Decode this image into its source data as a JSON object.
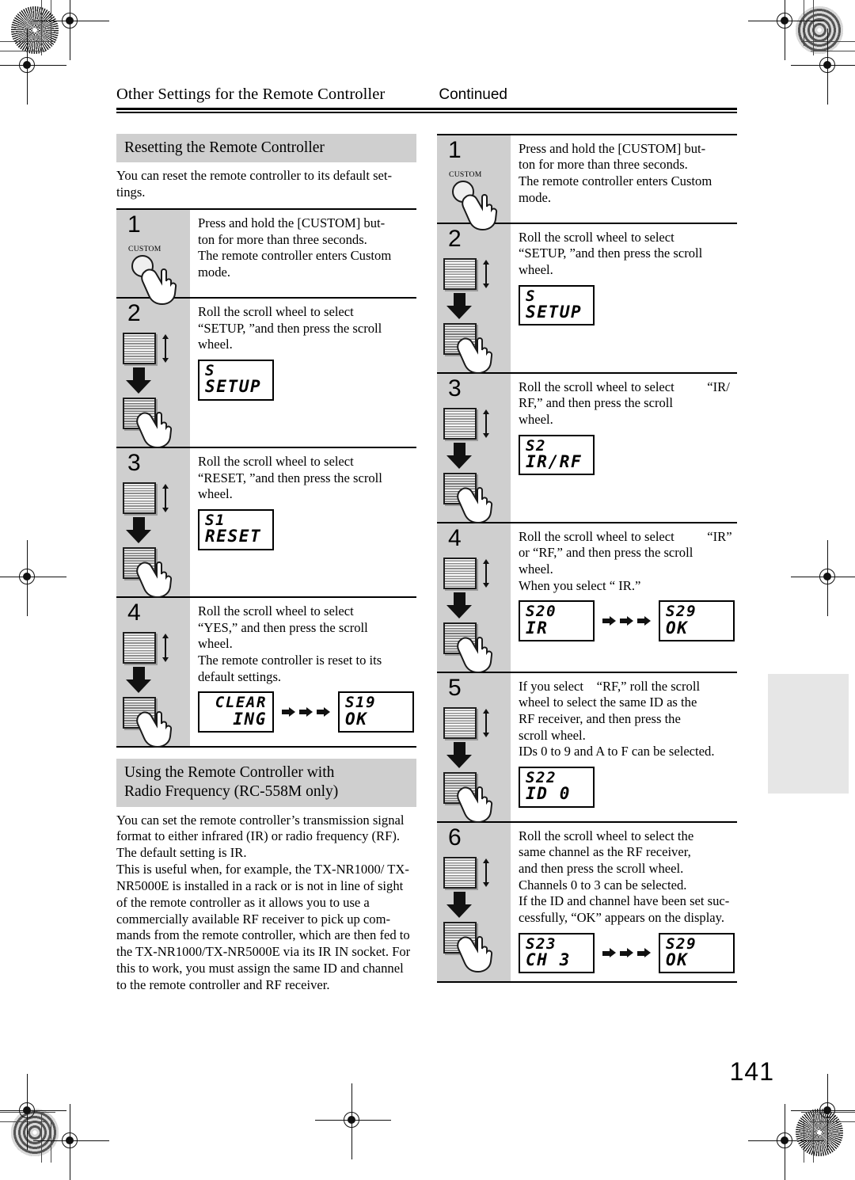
{
  "document": {
    "running_head": "Other Settings for the Remote Controller",
    "continued_label": "Continued",
    "page_number": "141"
  },
  "left_column": {
    "section": {
      "heading": "Resetting the Remote Controller",
      "intro": "You can reset the remote controller to its default set-tings."
    },
    "steps": [
      {
        "number": "1",
        "icon": "custom-button",
        "icon_label": "CUSTOM",
        "lines": [
          "Press and hold the [CUSTOM] but-",
          "ton for more than three seconds.",
          "The remote controller enters Custom",
          "mode."
        ],
        "displays": []
      },
      {
        "number": "2",
        "icon": "scroll-wheel",
        "lines": [
          "Roll the scroll wheel to select",
          "“SETUP, ”and then press the scroll",
          "wheel."
        ],
        "displays": [
          {
            "line1": "S",
            "line2": "SETUP",
            "align": "left"
          }
        ]
      },
      {
        "number": "3",
        "icon": "scroll-wheel",
        "lines": [
          "Roll the scroll wheel to select",
          "“RESET, ”and then press the scroll",
          "wheel."
        ],
        "displays": [
          {
            "line1": "S1",
            "line2": "RESET",
            "align": "left"
          }
        ]
      },
      {
        "number": "4",
        "icon": "scroll-wheel",
        "lines": [
          "Roll the scroll wheel to select",
          "“YES,” and then press the scroll",
          "wheel.",
          "The remote controller is reset to its",
          "default settings."
        ],
        "displays": [
          {
            "line1": "CLEAR",
            "line2": "ING",
            "align": "right"
          },
          {
            "arrows": 3
          },
          {
            "line1": "S19",
            "line2": "OK",
            "align": "left"
          }
        ]
      }
    ],
    "section2": {
      "heading_line1": "Using the Remote Controller with",
      "heading_line2": "Radio Frequency (RC-558M only)",
      "paragraphs": [
        "You can set the remote controller’s transmission signal format to either infrared (IR) or radio frequency (RF). The default setting is IR.",
        "This is useful when, for example, the TX-NR1000/ TX-NR5000E is installed in a rack or is not in line of sight of the remote controller as it allows you to use a commercially available RF receiver to pick up com-mands from the remote controller, which are then fed to the TX-NR1000/TX-NR5000E via its IR IN socket. For this to work, you must assign the same ID and channel to the remote controller and RF receiver."
      ]
    }
  },
  "right_column": {
    "steps": [
      {
        "number": "1",
        "icon": "custom-button",
        "icon_label": "CUSTOM",
        "lines": [
          "Press and hold the [CUSTOM] but-",
          "ton for more than three seconds.",
          "The remote controller enters Custom",
          "mode."
        ],
        "displays": []
      },
      {
        "number": "2",
        "icon": "scroll-wheel",
        "lines": [
          "Roll the scroll wheel to select",
          "“SETUP, ”and then press the scroll",
          "wheel."
        ],
        "displays": [
          {
            "line1": "S",
            "line2": "SETUP",
            "align": "left"
          }
        ]
      },
      {
        "number": "3",
        "icon": "scroll-wheel",
        "lines": [
          "Roll the scroll wheel to select          “IR/",
          "RF,” and then press the scroll",
          "wheel."
        ],
        "displays": [
          {
            "line1": "S2",
            "line2": "IR/RF",
            "align": "left"
          }
        ]
      },
      {
        "number": "4",
        "icon": "scroll-wheel",
        "lines": [
          "Roll the scroll wheel to select          “IR”",
          "or “RF,” and then press the scroll",
          "wheel.",
          "When you select “ IR.”"
        ],
        "displays": [
          {
            "line1": "S20",
            "line2": "IR",
            "align": "left"
          },
          {
            "arrows": 3
          },
          {
            "line1": "S29",
            "line2": "OK",
            "align": "left"
          }
        ]
      },
      {
        "number": "5",
        "icon": "scroll-wheel",
        "lines": [
          "If you select    “RF,” roll the scroll",
          "wheel to select the same ID as the",
          "RF receiver, and then press the",
          "scroll wheel.",
          "IDs 0 to 9 and A to F can be selected."
        ],
        "displays": [
          {
            "line1": "S22",
            "line2": "ID 0",
            "align": "left"
          }
        ]
      },
      {
        "number": "6",
        "icon": "scroll-wheel",
        "lines": [
          "Roll the scroll wheel to select the",
          "same channel as the RF receiver,",
          "and then press the scroll wheel.",
          "Channels 0 to 3 can be selected.",
          "If the ID and channel have been set suc-",
          "cessfully, “OK” appears on the display."
        ],
        "displays": [
          {
            "line1": "S23",
            "line2": "CH 3",
            "align": "left"
          },
          {
            "arrows": 3
          },
          {
            "line1": "S29",
            "line2": "OK",
            "align": "left"
          }
        ]
      }
    ]
  }
}
